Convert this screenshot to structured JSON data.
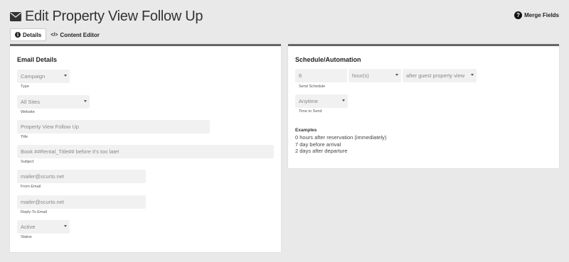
{
  "header": {
    "title": "Edit Property View Follow Up",
    "merge_fields_label": "Merge Fields"
  },
  "tabs": [
    {
      "label": "Details",
      "icon": "info-icon",
      "active": true
    },
    {
      "label": "Content Editor",
      "icon": "code-icon",
      "active": false
    }
  ],
  "email_details": {
    "title": "Email Details",
    "type": {
      "value": "Campaign",
      "label": "Type"
    },
    "website": {
      "value": "All Sites",
      "label": "Website"
    },
    "title_field": {
      "value": "Property View Follow Up",
      "label": "Title"
    },
    "subject": {
      "value": "Book ##Rental_Title## before it's too late!",
      "label": "Subject"
    },
    "from_email": {
      "value": "mailer@scurto.net",
      "label": "From Email"
    },
    "reply_to": {
      "value": "mailer@scurto.net",
      "label": "Reply-To Email"
    },
    "status": {
      "value": "Active",
      "label": "Status"
    }
  },
  "schedule": {
    "title": "Schedule/Automation",
    "amount": {
      "value": "8"
    },
    "unit": {
      "value": "hour(s)"
    },
    "trigger": {
      "value": "after guest property view"
    },
    "send_schedule_label": "Send Schedule",
    "time_to_send": {
      "value": "Anytime",
      "label": "Time to Send"
    },
    "examples_title": "Examples",
    "examples": [
      "0 hours after reservation (immediately)",
      "7 day before arrival",
      "2 days after departure"
    ]
  }
}
